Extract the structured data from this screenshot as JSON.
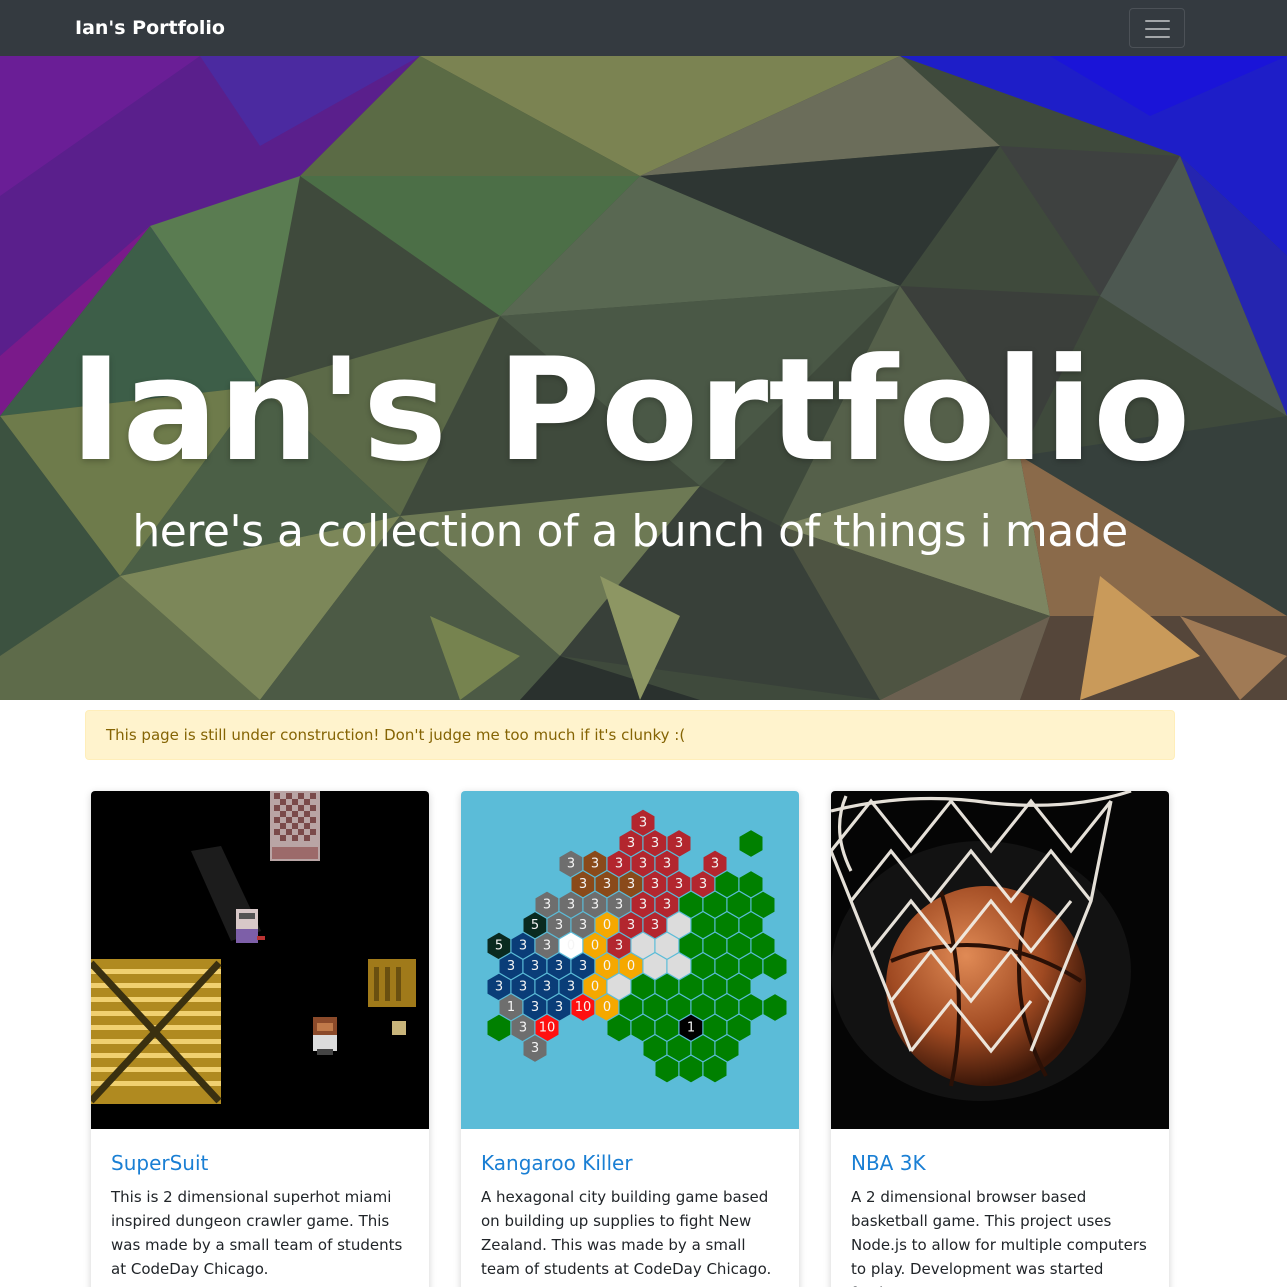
{
  "navbar": {
    "brand": "Ian's Portfolio",
    "toggle_icon": "hamburger-menu-icon"
  },
  "hero": {
    "title": "Ian's Portfolio",
    "subtitle": "here's a collection of a bunch of things i made"
  },
  "alert": {
    "text": "This page is still under construction! Don't judge me too much if it's clunky :("
  },
  "projects": [
    {
      "title": "SuperSuit",
      "description": "This is 2 dimensional superhot miami inspired dungeon crawler game. This was made by a small team of students at CodeDay Chicago."
    },
    {
      "title": "Kangaroo Killer",
      "description": "A hexagonal city building game based on building up supplies to fight New Zealand. This was made by a small team of students at CodeDay Chicago."
    },
    {
      "title": "NBA 3K",
      "description": "A 2 dimensional browser based basketball game. This project uses Node.js to allow for multiple computers to play. Development was started freshman year,"
    }
  ],
  "colors": {
    "navbar_bg": "#343a40",
    "link": "#1a7fd4",
    "alert_bg": "#fff3cd",
    "alert_text": "#856404"
  }
}
